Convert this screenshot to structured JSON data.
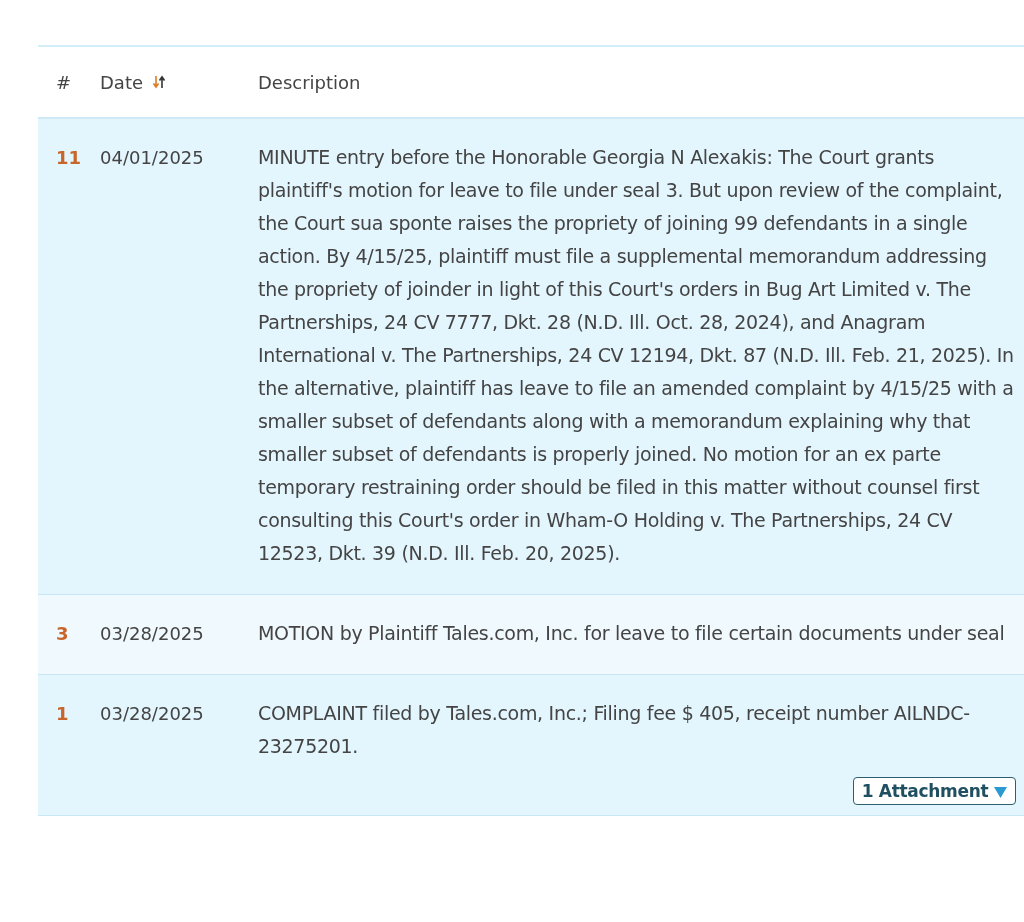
{
  "table": {
    "columns": [
      {
        "label": "#"
      },
      {
        "label": "Date",
        "sortable": true
      },
      {
        "label": "Description"
      }
    ],
    "rows": [
      {
        "number": "11",
        "date": "04/01/2025",
        "description": "MINUTE entry before the Honorable Georgia N Alexakis: The Court grants plaintiff's motion for leave to file under seal 3. But upon review of the complaint, the Court sua sponte raises the propriety of joining 99 defendants in a single action. By 4/15/25, plaintiff must file a supplemental memorandum addressing the propriety of joinder in light of this Court's orders in Bug Art Limited v. The Partnerships, 24 CV 7777, Dkt. 28 (N.D. Ill. Oct. 28, 2024), and Anagram International v. The Partnerships, 24 CV 12194, Dkt. 87 (N.D. Ill. Feb. 21, 2025). In the alternative, plaintiff has leave to file an amended complaint by 4/15/25 with a smaller subset of defendants along with a memorandum explaining why that smaller subset of defendants is properly joined. No motion for an ex parte temporary restraining order should be filed in this matter without counsel first consulting this Court's order in Wham-O Holding v. The Partnerships, 24 CV 12523, Dkt. 39 (N.D. Ill. Feb. 20, 2025)."
      },
      {
        "number": "3",
        "date": "03/28/2025",
        "description": "MOTION by Plaintiff Tales.com, Inc. for leave to file certain documents under seal"
      },
      {
        "number": "1",
        "date": "03/28/2025",
        "description": "COMPLAINT filed by Tales.com, Inc.; Filing fee $ 405, receipt number AILNDC-23275201.",
        "attachment": "1 Attachment"
      }
    ]
  }
}
